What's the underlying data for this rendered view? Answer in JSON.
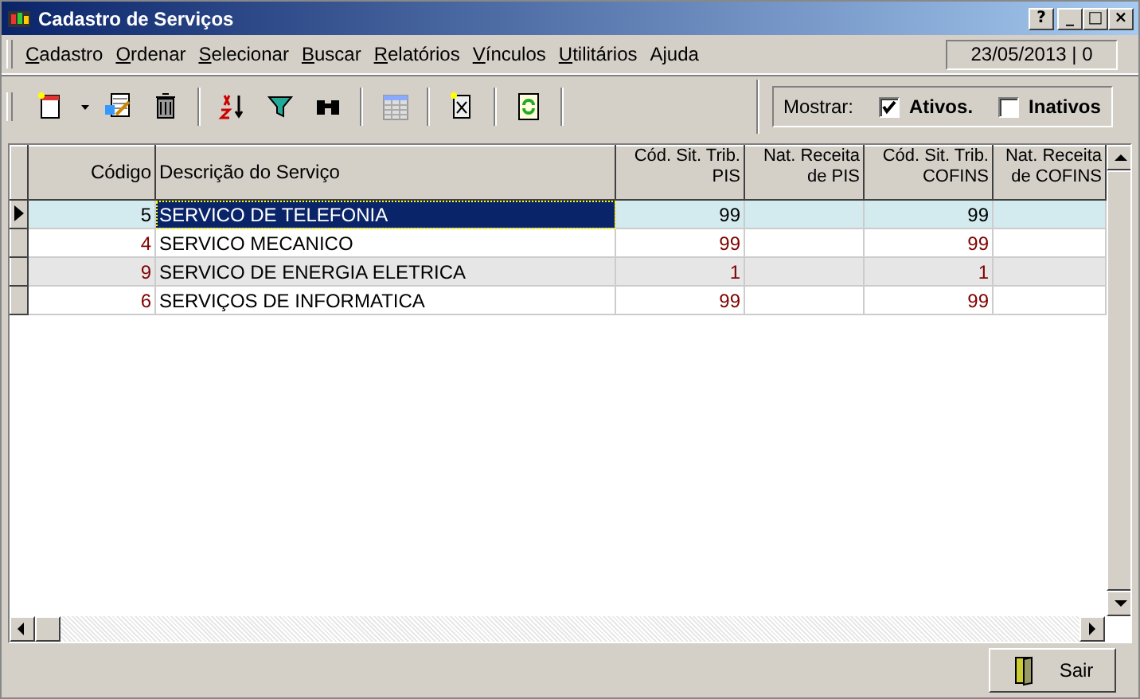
{
  "window": {
    "title": "Cadastro de Serviços",
    "buttons": [
      "?",
      "_",
      "□",
      "×"
    ]
  },
  "menu": [
    {
      "label": "Cadastro",
      "mnemonic": true
    },
    {
      "label": "Ordenar",
      "mnemonic": true
    },
    {
      "label": "Selecionar",
      "mnemonic": true
    },
    {
      "label": "Buscar",
      "mnemonic": true
    },
    {
      "label": "Relatórios",
      "mnemonic": true
    },
    {
      "label": "Vínculos",
      "mnemonic": true
    },
    {
      "label": "Utilitários",
      "mnemonic": true
    },
    {
      "label": "Ajuda",
      "mnemonic": false
    }
  ],
  "date_panel": "23/05/2013 | 0",
  "filter": {
    "label": "Mostrar:",
    "options": [
      {
        "label": "Ativos.",
        "checked": true
      },
      {
        "label": "Inativos",
        "checked": false
      }
    ]
  },
  "table": {
    "columns": [
      "Código",
      "Descrição do Serviço",
      "Cód. Sit. Trib. PIS",
      "Nat. Receita de PIS",
      "Cód. Sit. Trib. COFINS",
      "Nat. Receita de COFINS"
    ],
    "rows": [
      {
        "selected": true,
        "cells": [
          "5",
          "SERVICO DE TELEFONIA",
          "99",
          "",
          "99",
          ""
        ]
      },
      {
        "selected": false,
        "cells": [
          "4",
          "SERVICO MECANICO",
          "99",
          "",
          "99",
          ""
        ]
      },
      {
        "selected": false,
        "cells": [
          "9",
          "SERVICO DE ENERGIA ELETRICA",
          "1",
          "",
          "1",
          ""
        ]
      },
      {
        "selected": false,
        "cells": [
          "6",
          "SERVIÇOS DE INFORMATICA",
          "99",
          "",
          "99",
          ""
        ]
      }
    ]
  },
  "exit_button": "Sair"
}
